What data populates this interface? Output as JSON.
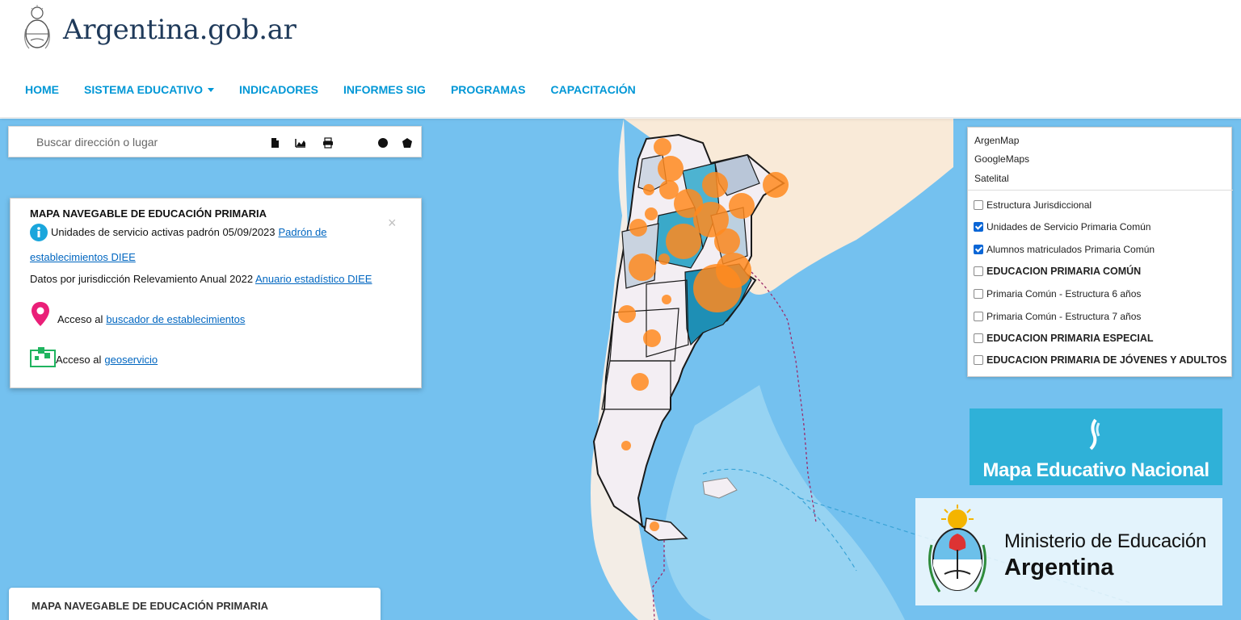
{
  "site": {
    "title": "Argentina.gob.ar",
    "logo_icon": "coat-of-arms-icon"
  },
  "nav": {
    "items": [
      "HOME",
      "SISTEMA EDUCATIVO",
      "INDICADORES",
      "INFORMES SIG",
      "PROGRAMAS",
      "CAPACITACIÓN"
    ],
    "dropdown_item_index": 1,
    "color": "#0097d6"
  },
  "search": {
    "placeholder": "Buscar dirección o lugar"
  },
  "toolbar": {
    "icons": [
      "document-icon",
      "area-chart-icon",
      "print-icon",
      "circle-draw-icon",
      "polygon-draw-icon"
    ]
  },
  "info_panel": {
    "title": "MAPA NAVEGABLE DE EDUCACIÓN PRIMARIA",
    "line1_text": "Unidades de servicio activas padrón 05/09/2023",
    "line1_link": "Padrón de",
    "line1_link_cont": "establecimientos DIEE",
    "line2_text": "Datos por jurisdicción Relevamiento Anual 2022",
    "line2_link": "Anuario estadístico DIEE",
    "line3_text": "Acceso al",
    "line3_link": "buscador de establecimientos",
    "line4_text": "Acceso al",
    "line4_link": "geoservicio",
    "close": "×"
  },
  "layers_panel": {
    "base_maps": [
      "ArgenMap",
      "GoogleMaps",
      "Satelital"
    ],
    "layers": [
      {
        "label": "Estructura Jurisdiccional",
        "checked": false,
        "bold": false
      },
      {
        "label": "Unidades de Servicio Primaria Común",
        "checked": true,
        "bold": false
      },
      {
        "label": "Alumnos matriculados Primaria Común",
        "checked": true,
        "bold": false
      },
      {
        "label": "EDUCACION PRIMARIA COMÚN",
        "checked": false,
        "bold": true
      },
      {
        "label": "Primaria Común - Estructura 6 años",
        "checked": false,
        "bold": false
      },
      {
        "label": "Primaria Común - Estructura 7 años",
        "checked": false,
        "bold": false
      },
      {
        "label": "EDUCACION PRIMARIA ESPECIAL",
        "checked": false,
        "bold": true
      },
      {
        "label": "EDUCACION PRIMARIA DE JÓVENES Y ADULTOS",
        "checked": false,
        "bold": true
      }
    ]
  },
  "logos": {
    "mapa_educativo": "Mapa Educativo Nacional",
    "ministerio_line1": "Ministerio de Educación",
    "ministerio_line2": "Argentina"
  },
  "bottom_card": {
    "title": "MAPA NAVEGABLE DE EDUCACIÓN PRIMARIA"
  },
  "colors": {
    "ocean": "#74c1ef",
    "land": "#f9ead8",
    "bubble": "#ff8a1e",
    "province_dark": "#1e8fb5"
  }
}
